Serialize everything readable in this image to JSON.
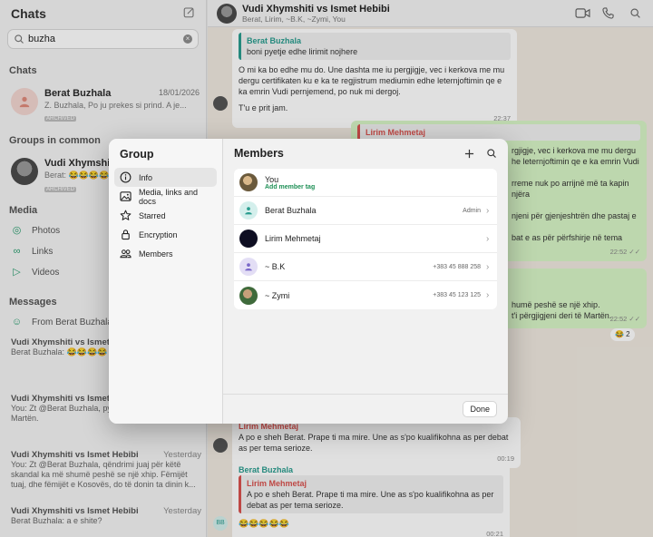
{
  "sidebar": {
    "title": "Chats",
    "search": {
      "value": "buzha"
    },
    "chats_section": "Chats",
    "chat": {
      "name": "Berat Buzhala",
      "date": "18/01/2026",
      "preview": "Z. Buzhala, Po ju prekes si prind. A je...",
      "badge": "ARCHIVED"
    },
    "groups_section": "Groups in common",
    "group": {
      "name": "Vudi Xhymshiti v",
      "preview": "Berat: 😂😂😂😂",
      "badge": "ARCHIVED"
    },
    "media_section": "Media",
    "media_items": [
      "Photos",
      "Links",
      "Videos"
    ],
    "messages_section": "Messages",
    "messages_from": "From Berat Buzhala",
    "messages": [
      {
        "title": "Vudi Xhymshiti vs Ismet H",
        "date": "",
        "text": "Berat Buzhala: 😂😂😂😂"
      },
      {
        "title": "Vudi Xhymshiti vs Ismet H",
        "date": "",
        "text": "You: Zt @Berat Buzhala, py... t'përgjigjeni deri të Martën."
      },
      {
        "title": "Vudi Xhymshiti vs Ismet Hebibi",
        "date": "Yesterday",
        "text": "You: Zt @Berat Buzhala, qëndrimi juaj për këtë skandal ka më shumë peshë se një xhip. Fëmijët tuaj, dhe fëmijët e Kosovës, do të donin ta dinin k..."
      },
      {
        "title": "Vudi Xhymshiti vs Ismet Hebibi",
        "date": "Yesterday",
        "text": "Berat Buzhala: a e shite?"
      }
    ]
  },
  "chat": {
    "title": "Vudi Xhymshiti vs Ismet Hebibi",
    "subtitle": "Berat, Lirim, ~B.K, ~Zymi, You",
    "bubble1_quote_name": "Berat Buzhala",
    "bubble1_quote_text": "boni pyetje edhe lirimit nojhere",
    "bubble1_text": "O mi ka bo edhe mu do. Une dashta me iu pergjigje, vec i kerkova me mu dergu certifikaten ku e ka te regjistrum mediumin edhe leternjoftimin qe e ka emrin Vudi pernjemend, po nuk mi dergoj.",
    "bubble1_text2": "T'u e prit jam.",
    "bubble1_time": "22:37",
    "bubble2_quote_name": "Lirim Mehmetaj",
    "bubble2_lines": [
      "rgjigje, vec i kerkova me mu dergu",
      "he leternjoftimin qe e ka emrin Vudi",
      "",
      "rreme nuk po arrijnë më ta kapin njëra",
      "",
      "njeni për gjenjeshtrën dhe pastaj e",
      "",
      "bat e as për përfshirje në tema"
    ],
    "bubble2_time": "22:52 ✓✓",
    "bubble3_text": "humë peshë se një xhip.",
    "bubble3_text2": "t'i përgjigjeni deri të Martën.",
    "bubble3_time": "22:52 ✓✓",
    "reaction": "😂 2",
    "bubble4_name": "Lirim Mehmetaj",
    "bubble4_text": "A po e sheh Berat. Prape ti ma mire. Une as s'po kualifikohna as per debat as per tema serioze.",
    "bubble4_time": "00:19",
    "bubble5_name": "Berat Buzhala",
    "bubble5_quote_name": "Lirim Mehmetaj",
    "bubble5_quote_text": "A po e sheh Berat. Prape ti ma mire. Une as s'po kualifikohna as per debat as per tema serioze.",
    "bubble5_text": "😂😂😂😂😂",
    "bubble5_time": "00:21",
    "bb_initials": "BB"
  },
  "modal": {
    "nav_title": "Group",
    "nav_items": [
      {
        "label": "Info",
        "icon": "info-icon"
      },
      {
        "label": "Media, links and docs",
        "icon": "image-icon"
      },
      {
        "label": "Starred",
        "icon": "star-icon"
      },
      {
        "label": "Encryption",
        "icon": "lock-icon"
      },
      {
        "label": "Members",
        "icon": "people-icon"
      }
    ],
    "main_title": "Members",
    "members": [
      {
        "name": "You",
        "sub": "Add member tag",
        "meta": ""
      },
      {
        "name": "Berat Buzhala",
        "sub": "",
        "meta": "Admin"
      },
      {
        "name": "Lirim Mehmetaj",
        "sub": "",
        "meta": ""
      },
      {
        "name": "~ B.K",
        "sub": "",
        "meta": "+383 45 888 258"
      },
      {
        "name": "~ Zymi",
        "sub": "",
        "meta": "+383 45 123 125"
      }
    ],
    "done_label": "Done"
  },
  "colors": {
    "accent_green": "#1d8f55",
    "teal": "#2a9d8f",
    "quote_red": "#d9534f"
  }
}
